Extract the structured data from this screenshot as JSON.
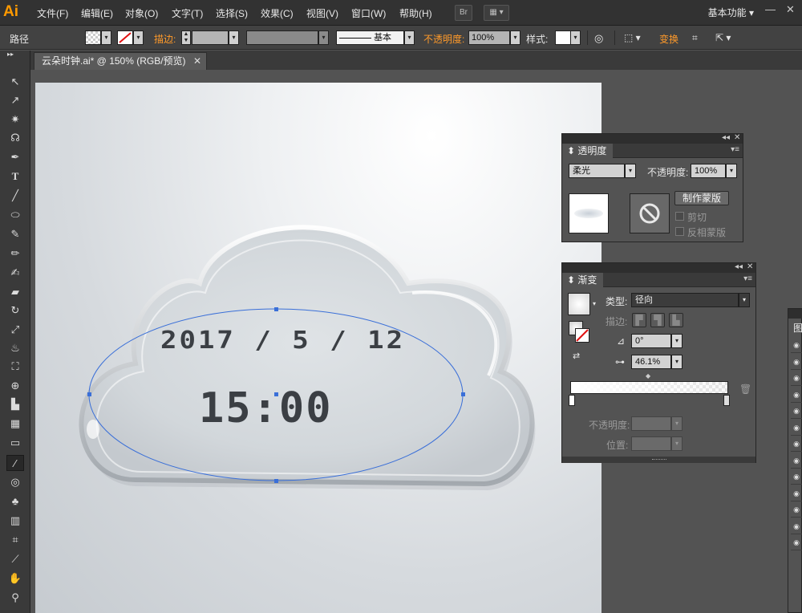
{
  "app": {
    "logo": "Ai",
    "menu": [
      "文件(F)",
      "编辑(E)",
      "对象(O)",
      "文字(T)",
      "选择(S)",
      "效果(C)",
      "视图(V)",
      "窗口(W)",
      "帮助(H)"
    ],
    "bridge_button": "Br",
    "workspace": "基本功能"
  },
  "control_bar": {
    "object_type": "路径",
    "stroke_label": "描边:",
    "stroke_style": "基本",
    "opacity_label": "不透明度:",
    "opacity_value": "100%",
    "style_label": "样式:",
    "transform_label": "变换"
  },
  "document": {
    "tab_title": "云朵时钟.ai* @ 150% (RGB/预览)"
  },
  "artwork": {
    "date": "2017/5/12",
    "time": "15:00"
  },
  "transparency_panel": {
    "title": "透明度",
    "blend_mode": "柔光",
    "opacity_label": "不透明度:",
    "opacity_value": "100%",
    "make_mask_button": "制作蒙版",
    "clip_label": "剪切",
    "invert_mask_label": "反相蒙版"
  },
  "gradient_panel": {
    "title": "渐变",
    "type_label": "类型:",
    "type_value": "径向",
    "stroke_label": "描边:",
    "angle_value": "0°",
    "aspect_value": "46.1%",
    "opacity_label": "不透明度:",
    "position_label": "位置:"
  },
  "layers_panel": {
    "tab_initial": "图"
  }
}
